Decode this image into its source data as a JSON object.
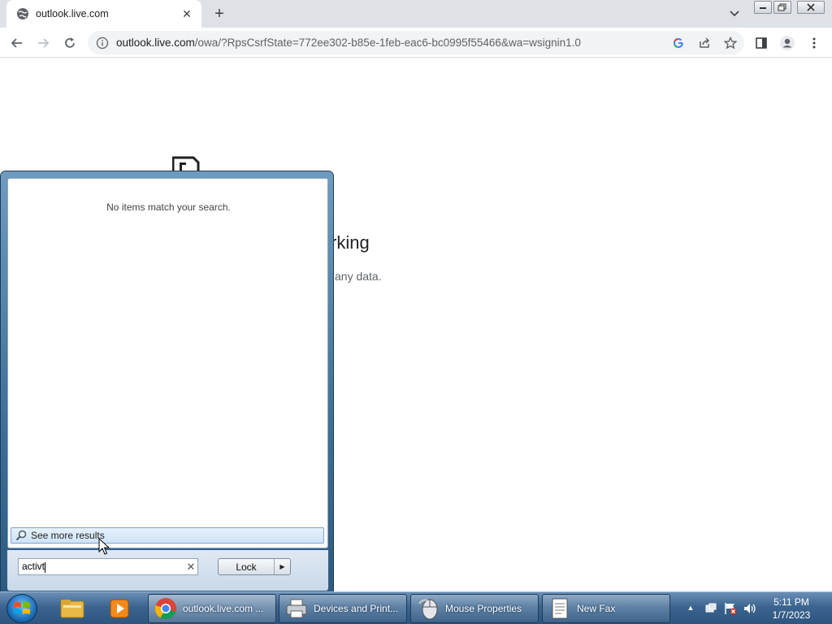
{
  "browser": {
    "tab": {
      "title": "outlook.live.com",
      "favicon": "globe-icon"
    },
    "new_tab_glyph": "+",
    "url_host": "outlook.live.com",
    "url_path": "/owa/?RpsCsrfState=772ee302-b85e-1feb-eac6-bc0995f55466&wa=wsignin1.0"
  },
  "page": {
    "heading_fragment": "rking",
    "subtext_fragment": "any data."
  },
  "start_menu": {
    "no_items_text": "No items match your search.",
    "see_more_label": "See more results",
    "search_value": "activt",
    "lock_label": "Lock"
  },
  "taskbar": {
    "tasks": [
      {
        "label": "outlook.live.com ...",
        "icon": "chrome-icon"
      },
      {
        "label": "Devices and Print...",
        "icon": "printer-icon"
      },
      {
        "label": "Mouse Properties",
        "icon": "mouse-icon"
      },
      {
        "label": "New Fax",
        "icon": "fax-icon"
      }
    ],
    "clock": {
      "time": "5:11 PM",
      "date": "1/7/2023"
    }
  },
  "colors": {
    "taskbar": "#3b6590",
    "start_menu": "#3f6f96",
    "chrome_tabstrip": "#dee1e6"
  }
}
